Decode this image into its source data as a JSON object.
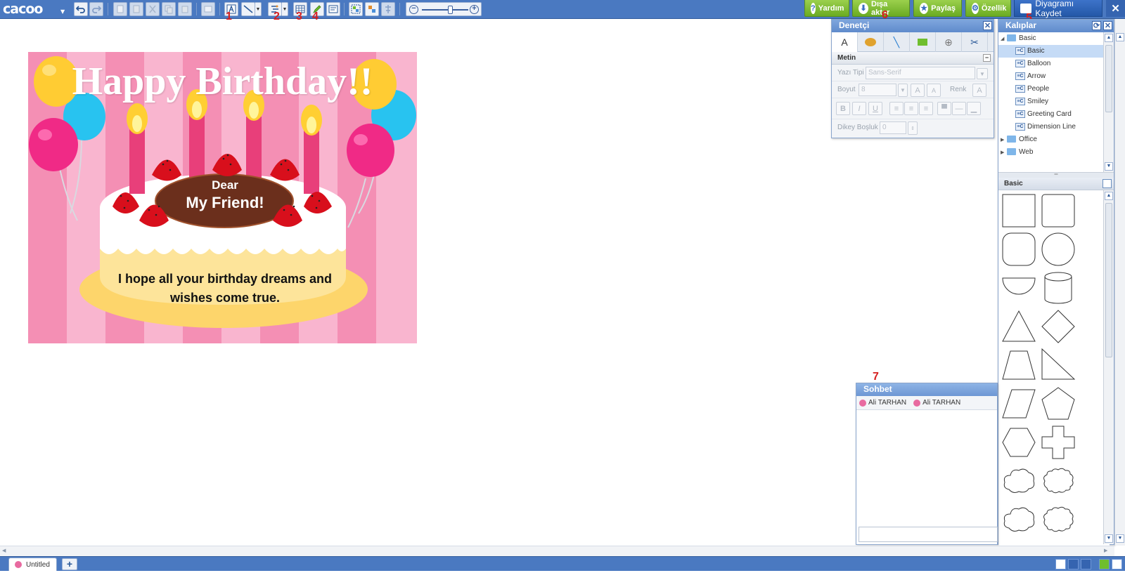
{
  "app": {
    "logo": "cacoo",
    "logo_caret": "▼"
  },
  "toolbar": {
    "buttons": [
      {
        "name": "undo"
      },
      {
        "name": "redo"
      },
      {
        "name": "new-page"
      },
      {
        "name": "paste"
      },
      {
        "name": "cut"
      },
      {
        "name": "copy"
      },
      {
        "name": "paste-format"
      },
      {
        "name": "shape"
      },
      {
        "name": "text"
      },
      {
        "name": "connector"
      },
      {
        "name": "stencil"
      },
      {
        "name": "table"
      },
      {
        "name": "pen"
      },
      {
        "name": "sticky"
      },
      {
        "name": "group"
      },
      {
        "name": "ungroup"
      },
      {
        "name": "align"
      }
    ],
    "zoom": {
      "minus": "−",
      "plus": "+",
      "value_fraction": 0.6
    },
    "right_buttons": [
      {
        "label": "Yardım",
        "icon": "?"
      },
      {
        "label": "Dışa aktar",
        "icon": "⬇"
      },
      {
        "label": "Paylaş",
        "icon": "★"
      },
      {
        "label": "Özellik",
        "icon": "⚙"
      }
    ],
    "save_label": "Diyagramı Kaydet",
    "close_label": "✕"
  },
  "markers": [
    "1",
    "2",
    "3",
    "4",
    "5",
    "6",
    "7"
  ],
  "canvas": {
    "title": "Happy Birthday!!",
    "dear": "Dear",
    "friend": "My Friend!",
    "message_line1": "I hope all your birthday dreams and",
    "message_line2": "wishes come true."
  },
  "inspector": {
    "title": "Denetçi",
    "close": "✕",
    "tabs": [
      "A",
      "✎",
      "╲",
      "▭",
      "⊕",
      "✂"
    ],
    "section": "Metin",
    "section_collapse": "−",
    "font_label": "Yazı Tipi",
    "font_value": "Sans-Serif",
    "size_label": "Boyut",
    "size_value": "8",
    "color_label": "Renk",
    "bold": "B",
    "italic": "I",
    "underline": "U",
    "spacing_label": "Dikey Boşluk",
    "spacing_value": "0"
  },
  "templates": {
    "title": "Kalıplar",
    "close": "✕",
    "tree": [
      {
        "label": "Basic",
        "level": 0,
        "type": "folder-open"
      },
      {
        "label": "Basic",
        "level": 1,
        "type": "stencil",
        "selected": true
      },
      {
        "label": "Balloon",
        "level": 1,
        "type": "stencil"
      },
      {
        "label": "Arrow",
        "level": 1,
        "type": "stencil"
      },
      {
        "label": "People",
        "level": 1,
        "type": "stencil"
      },
      {
        "label": "Smiley",
        "level": 1,
        "type": "stencil"
      },
      {
        "label": "Greeting Card",
        "level": 1,
        "type": "stencil"
      },
      {
        "label": "Dimension Line",
        "level": 1,
        "type": "stencil"
      },
      {
        "label": "Office",
        "level": 0,
        "type": "folder"
      },
      {
        "label": "Web",
        "level": 0,
        "type": "folder"
      }
    ],
    "shapes_title": "Basic"
  },
  "chat": {
    "title": "Sohbet",
    "users": [
      "Ali TARHAN",
      "Ali TARHAN"
    ]
  },
  "pages": {
    "tab_label": "Untitled",
    "add": "+"
  },
  "colors": {
    "accent": "#4a79c1",
    "green": "#7bbd34",
    "pink_bg": "#f9b5cf"
  }
}
